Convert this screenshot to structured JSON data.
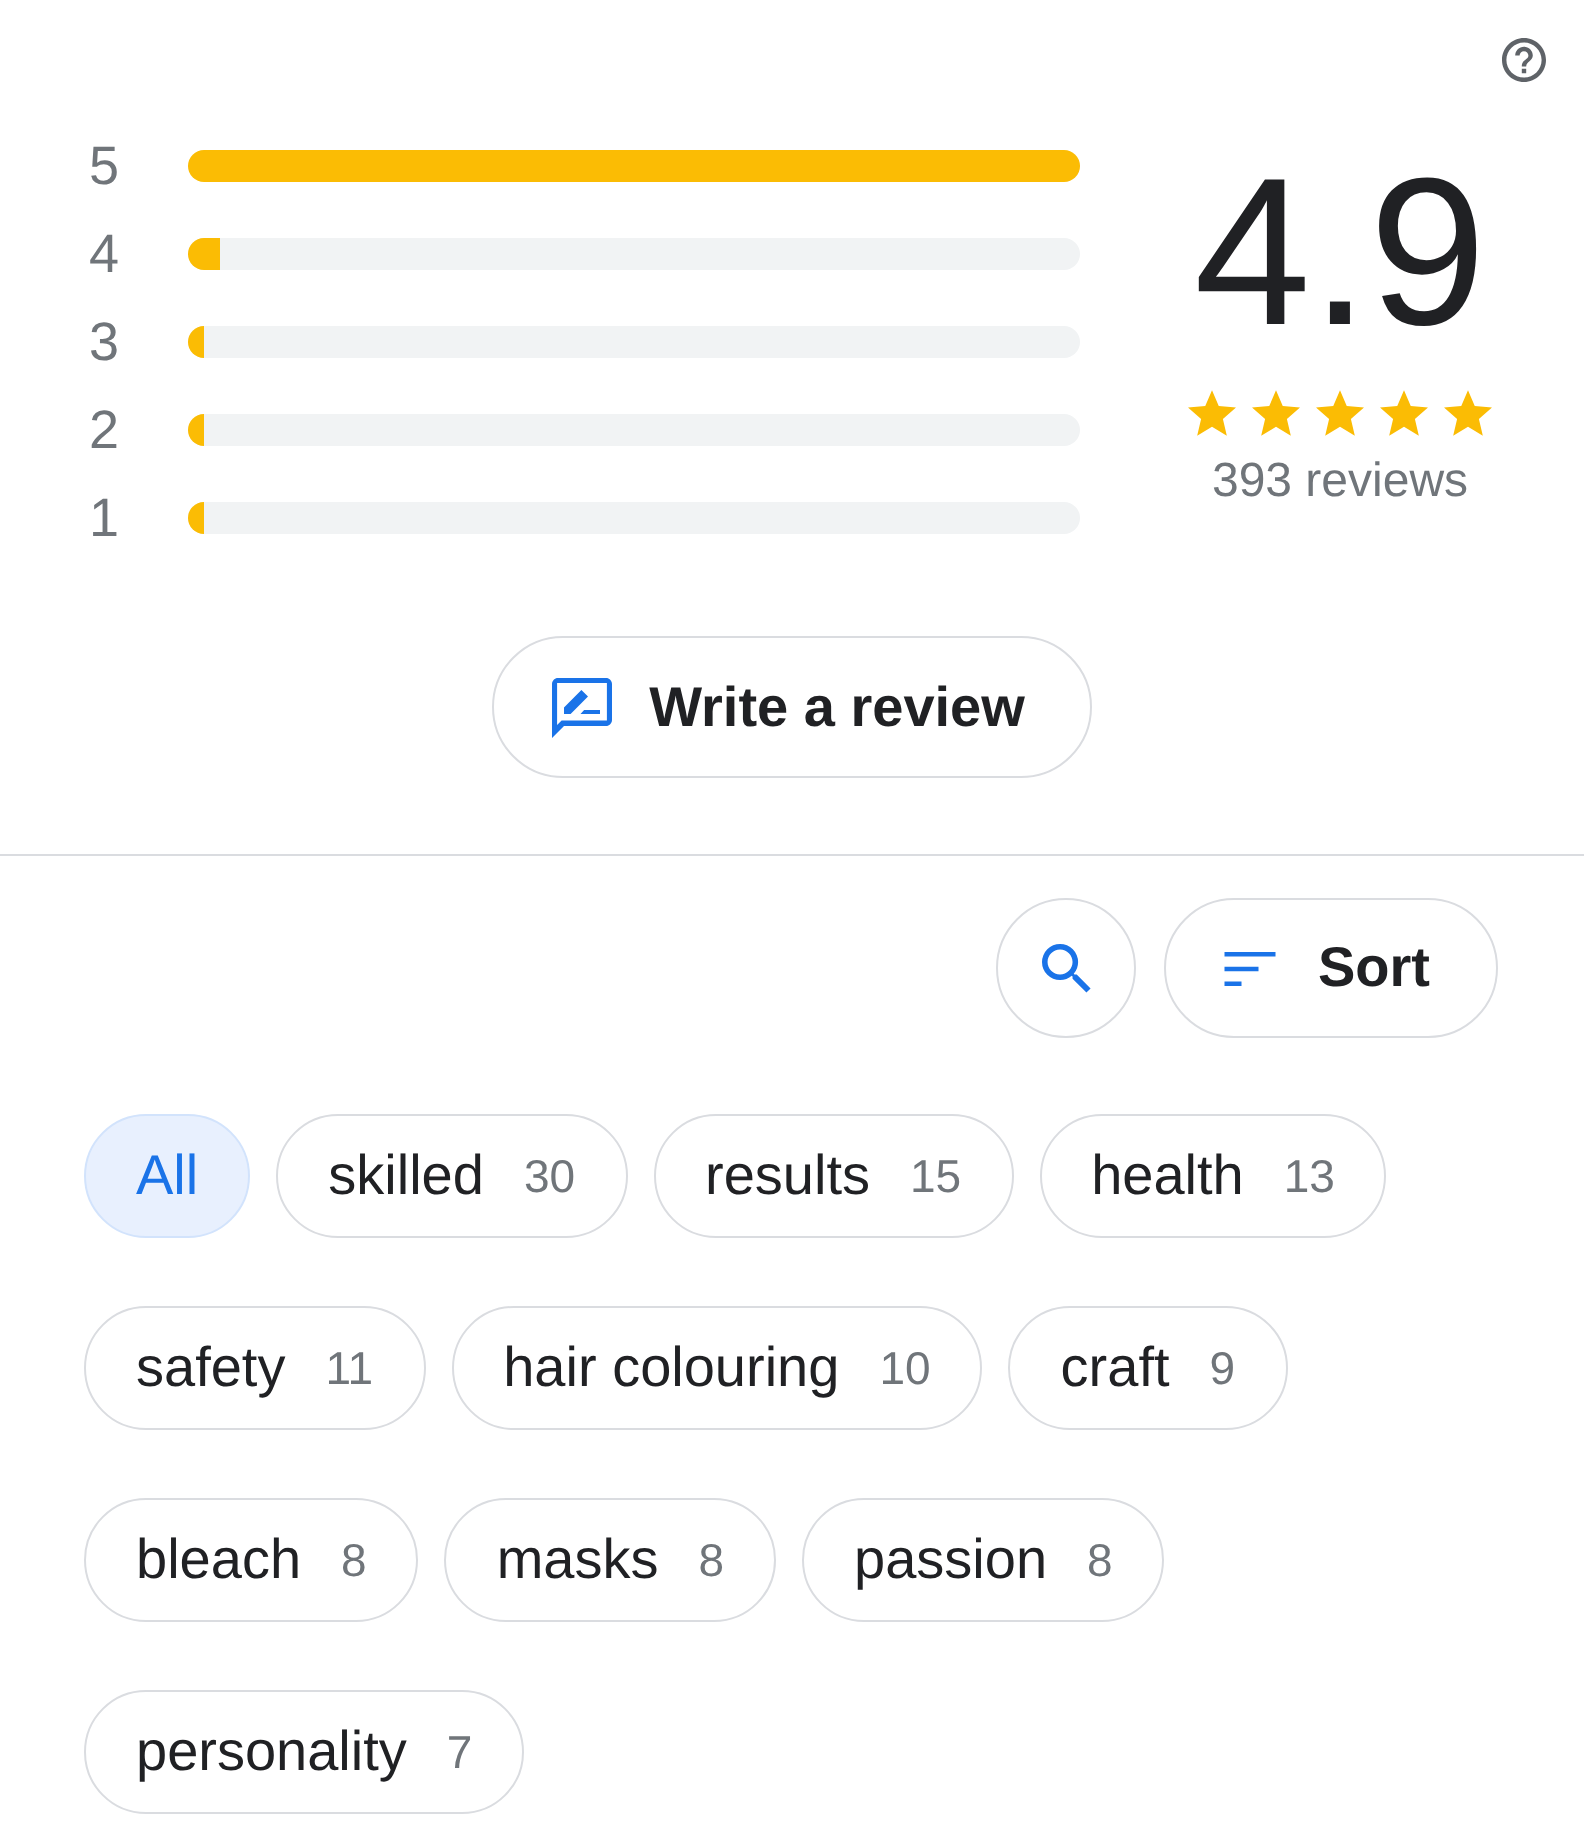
{
  "rating_breakdown": [
    {
      "label": "5",
      "level": 1
    },
    {
      "label": "4",
      "level": 0.036
    },
    {
      "label": "3",
      "level": 0.018
    },
    {
      "label": "2",
      "level": 0.018
    },
    {
      "label": "1",
      "level": 0.018
    }
  ],
  "summary": {
    "score": "4.9",
    "stars": 5,
    "review_count": "393 reviews"
  },
  "write_review_button": {
    "label": "Write a review"
  },
  "sort_button": {
    "label": "Sort"
  },
  "topic_chips": [
    {
      "label": "All",
      "selected": true
    },
    {
      "label": "skilled",
      "count": "30",
      "selected": false
    },
    {
      "label": "results",
      "count": "15",
      "selected": false
    },
    {
      "label": "health",
      "count": "13",
      "selected": false
    },
    {
      "label": "safety",
      "count": "11",
      "selected": false
    },
    {
      "label": "hair colouring",
      "count": "10",
      "selected": false
    },
    {
      "label": "craft",
      "count": "9",
      "selected": false
    },
    {
      "label": "bleach",
      "count": "8",
      "selected": false
    },
    {
      "label": "masks",
      "count": "8",
      "selected": false
    },
    {
      "label": "passion",
      "count": "8",
      "selected": false
    },
    {
      "label": "personality",
      "count": "7",
      "selected": false
    }
  ]
}
